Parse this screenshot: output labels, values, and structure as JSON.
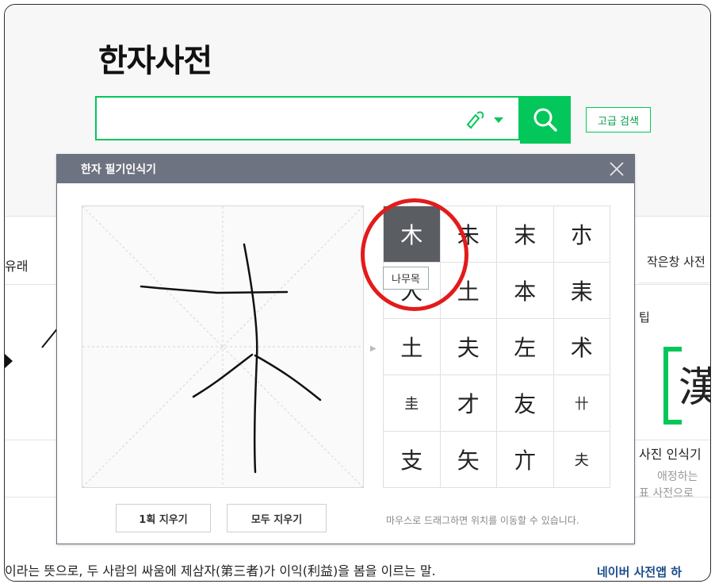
{
  "page": {
    "title": "한자사전"
  },
  "search": {
    "placeholder": "",
    "advanced_label": "고급 검색"
  },
  "background": {
    "left_tab": "유래",
    "right_tab": "작은창 사전",
    "tip_label": "팁",
    "right_big_hanja": "漢",
    "right_heading": "사진 인식기",
    "right_line1": "애정하는 ",
    "right_line2": "표 사전으로 ",
    "bottom_sentence": "이라는 뜻으로, 두 사람의 싸움에 제삼자(第三者)가 이익(利益)을 봄을 이르는 말.",
    "app_banner": "네이버 사전앱 하"
  },
  "popup": {
    "title": "한자 필기인식기",
    "tooltip": "나무목",
    "clear_one_label": "1획 지우기",
    "clear_all_label": "모두 지우기",
    "hint": "마우스로 드래그하면 위치를 이동할 수 있습니다.",
    "candidates": [
      "木",
      "未",
      "末",
      "朩",
      "大",
      "土",
      "本",
      "耒",
      "土",
      "夫",
      "左",
      "术",
      "圭",
      "才",
      "友",
      "卄",
      "支",
      "矢",
      "亣",
      "夫"
    ]
  },
  "colors": {
    "accent": "#03c75a",
    "header": "#6e7382",
    "selected": "#5a5d62",
    "annotation": "#e31b1b"
  }
}
